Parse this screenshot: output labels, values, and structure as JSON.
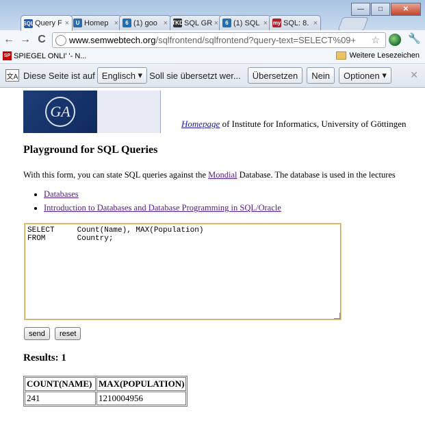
{
  "browser": {
    "tabs": [
      {
        "label": "Query F",
        "favicon": "sql-icon",
        "color": "#2a5aa5",
        "glyph": "SQL"
      },
      {
        "label": "Homep",
        "favicon": "globe-icon",
        "color": "#2b6bb0",
        "glyph": "U"
      },
      {
        "label": "(1) goo",
        "favicon": "facebook-like-icon",
        "color": "#1f6fb5",
        "glyph": "6"
      },
      {
        "label": "SQL GR",
        "favicon": "tkd-icon",
        "color": "#333333",
        "glyph": "TKD"
      },
      {
        "label": "(1) SQL",
        "favicon": "facebook-like-icon",
        "color": "#1f6fb5",
        "glyph": "6"
      },
      {
        "label": "SQL: 8.",
        "favicon": "mysql-icon",
        "color": "#b0212b",
        "glyph": "my"
      }
    ],
    "url_domain": "www.semwebtech.org",
    "url_path": "/sqlfrontend/sqlfrontend?query-text=SELECT%09+",
    "bookmark_item": "SPIEGEL ONLI' '- N...",
    "bookmark_folder": "Weitere Lesezeichen"
  },
  "translate": {
    "text1": "Diese Seite ist auf",
    "language": "Englisch",
    "text2": "Soll sie übersetzt wer...",
    "translate_btn": "Übersetzen",
    "no_btn": "Nein",
    "options_btn": "Optionen"
  },
  "page": {
    "homepage_link": "Homepage",
    "homepage_suffix": " of Institute for Informatics, University of Göttingen",
    "heading": "Playground for SQL Queries",
    "intro_prefix": "With this form, you can state SQL queries against the ",
    "intro_link": "Mondial",
    "intro_suffix": " Database. The database is used in the lectures",
    "links": [
      "Databases",
      "Introduction to Databases and Database Programming in SQL/Oracle"
    ],
    "query": "SELECT     Count(Name), MAX(Population)\nFROM       Country;",
    "send_label": "send",
    "reset_label": "reset",
    "results_title": "Results: 1",
    "columns": [
      "COUNT(NAME)",
      "MAX(POPULATION)"
    ],
    "rows": [
      [
        "241",
        "1210004956"
      ]
    ]
  }
}
